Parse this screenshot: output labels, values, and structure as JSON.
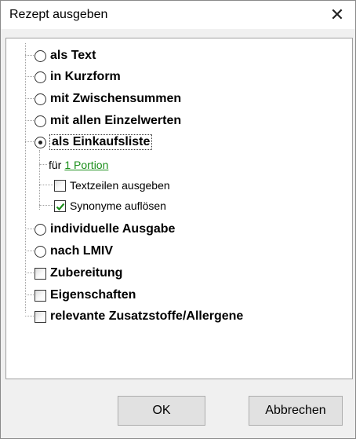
{
  "dialog": {
    "title": "Rezept ausgeben",
    "close_glyph": "✕"
  },
  "options": [
    {
      "label": "als Text",
      "type": "radio",
      "checked": false
    },
    {
      "label": "in Kurzform",
      "type": "radio",
      "checked": false
    },
    {
      "label": "mit Zwischensummen",
      "type": "radio",
      "checked": false
    },
    {
      "label": "mit allen Einzelwerten",
      "type": "radio",
      "checked": false
    },
    {
      "label": "als Einkaufsliste",
      "type": "radio",
      "checked": true
    }
  ],
  "sub": {
    "fuer_prefix": "für",
    "portion_link": "1 Portion",
    "textzeilen": {
      "label": "Textzeilen ausgeben",
      "checked": false
    },
    "synonyme": {
      "label": "Synonyme auflösen",
      "checked": true
    }
  },
  "options2": [
    {
      "label": "individuelle Ausgabe",
      "type": "radio",
      "checked": false
    },
    {
      "label": "nach LMIV",
      "type": "radio",
      "checked": false
    }
  ],
  "checks": [
    {
      "label": "Zubereitung",
      "checked": false
    },
    {
      "label": "Eigenschaften",
      "checked": false
    },
    {
      "label": "relevante Zusatzstoffe/Allergene",
      "checked": false
    }
  ],
  "buttons": {
    "ok": "OK",
    "cancel": "Abbrechen"
  },
  "colors": {
    "link": "#1a8f1a",
    "check_mark": "#1a8f1a"
  }
}
